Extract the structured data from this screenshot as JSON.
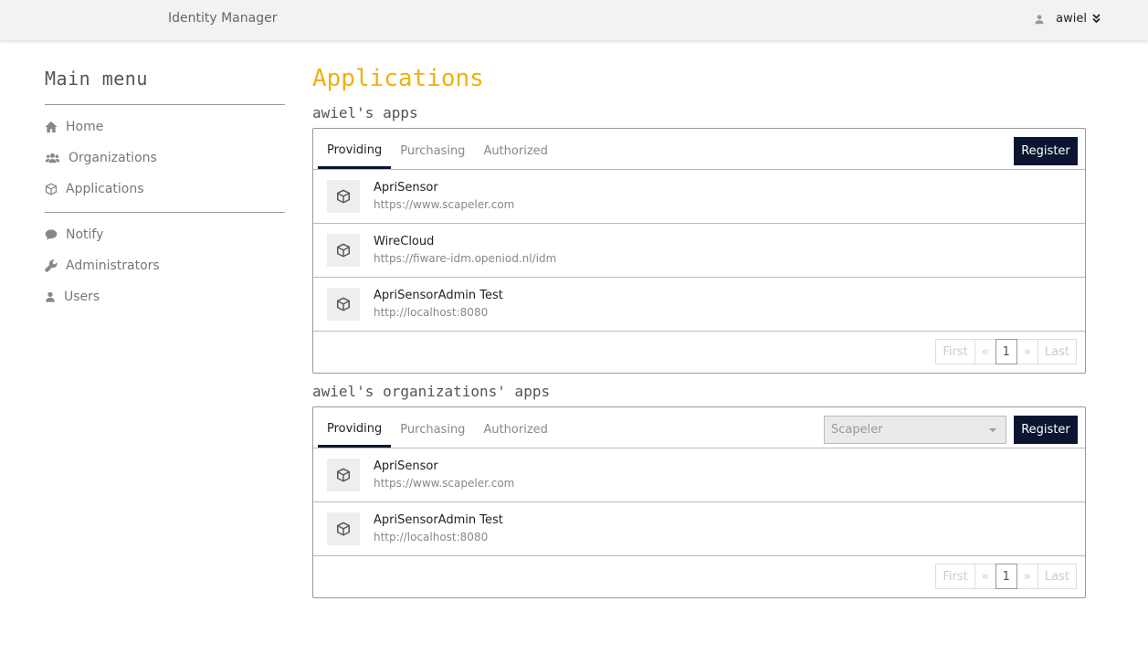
{
  "header": {
    "brand": "Identity Manager",
    "username": "awiel"
  },
  "sidebar": {
    "title": "Main menu",
    "items": [
      {
        "label": "Home",
        "icon": "home-icon"
      },
      {
        "label": "Organizations",
        "icon": "users-icon"
      },
      {
        "label": "Applications",
        "icon": "cube-icon"
      }
    ],
    "items2": [
      {
        "label": "Notify",
        "icon": "comment-icon"
      },
      {
        "label": "Administrators",
        "icon": "wrench-icon"
      },
      {
        "label": "Users",
        "icon": "user-icon"
      }
    ]
  },
  "main": {
    "title": "Applications",
    "my_apps": {
      "title": "awiel's apps",
      "tabs": [
        "Providing",
        "Purchasing",
        "Authorized"
      ],
      "register_label": "Register",
      "apps": [
        {
          "name": "ApriSensor",
          "url": "https://www.scapeler.com"
        },
        {
          "name": "WireCloud",
          "url": "https://fiware-idm.openiod.nl/idm"
        },
        {
          "name": "ApriSensorAdmin Test",
          "url": "http://localhost:8080"
        }
      ],
      "pager": {
        "first": "First",
        "prev": "«",
        "current": "1",
        "next": "»",
        "last": "Last"
      }
    },
    "org_apps": {
      "title": "awiel's organizations' apps",
      "tabs": [
        "Providing",
        "Purchasing",
        "Authorized"
      ],
      "org_select": "Scapeler",
      "register_label": "Register",
      "apps": [
        {
          "name": "ApriSensor",
          "url": "https://www.scapeler.com"
        },
        {
          "name": "ApriSensorAdmin Test",
          "url": "http://localhost:8080"
        }
      ],
      "pager": {
        "first": "First",
        "prev": "«",
        "current": "1",
        "next": "»",
        "last": "Last"
      }
    }
  },
  "colors": {
    "accent": "#f0b010",
    "primary": "#0a1530"
  }
}
